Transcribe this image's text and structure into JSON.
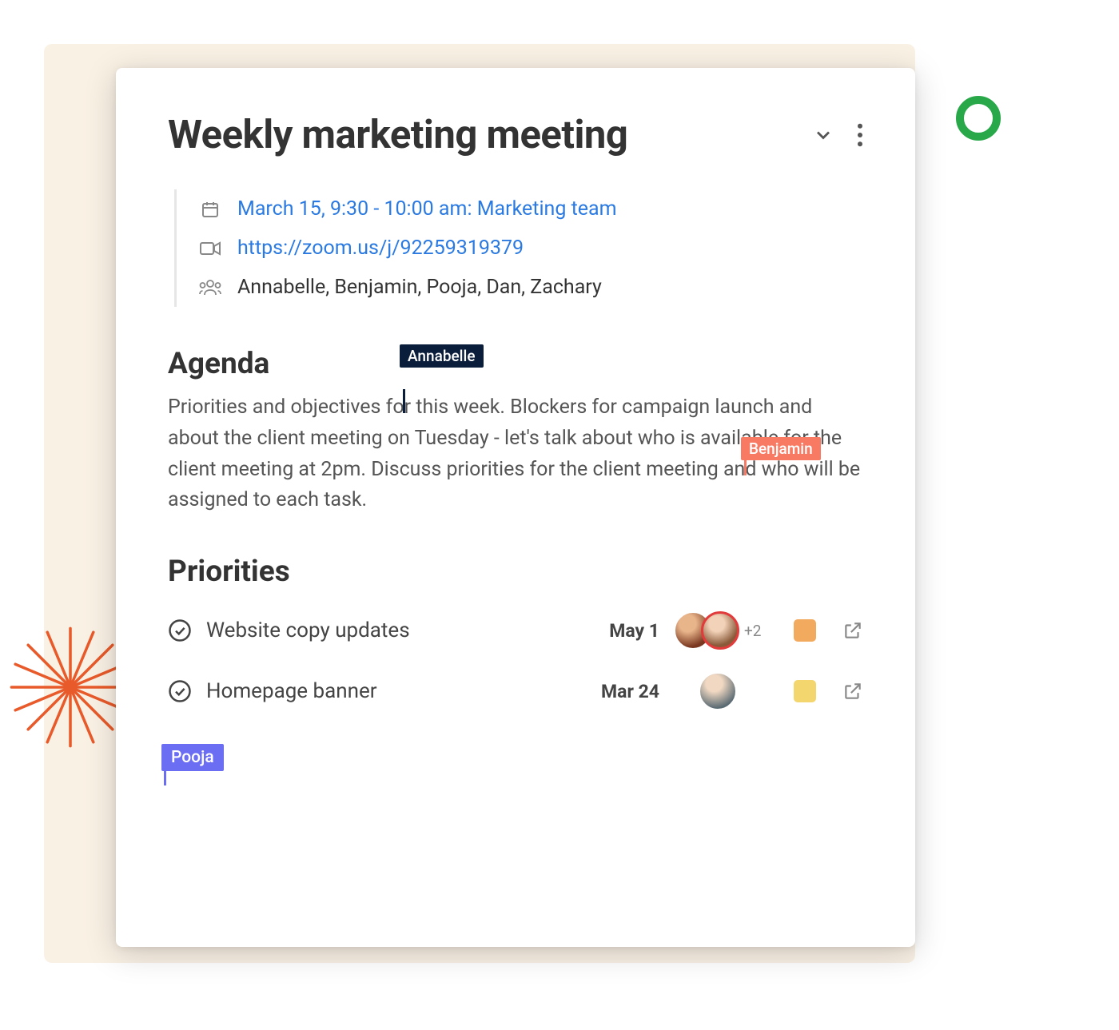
{
  "header": {
    "title": "Weekly marketing meeting"
  },
  "meta": {
    "date_label": "March 15, 9:30 - 10:00 am: Marketing team",
    "video_link": "https://zoom.us/j/92259319379",
    "attendees": "Annabelle, Benjamin, Pooja, Dan, Zachary"
  },
  "agenda": {
    "heading": "Agenda",
    "body": "Priorities and objectives for this week. Blockers for campaign launch and about the client meeting on Tuesday - let's talk about who is available for the client meeting at 2pm.  Discuss priorities for the client meeting and who will be assigned to each task."
  },
  "cursors": {
    "annabelle": "Annabelle",
    "benjamin": "Benjamin",
    "pooja": "Pooja"
  },
  "priorities": {
    "heading": "Priorities",
    "items": [
      {
        "title": "Website copy updates",
        "date": "May 1",
        "avatar_more": "+2",
        "color": "#f2aa5e"
      },
      {
        "title": "Homepage banner",
        "date": "Mar 24",
        "color": "#f3d66e"
      }
    ]
  }
}
